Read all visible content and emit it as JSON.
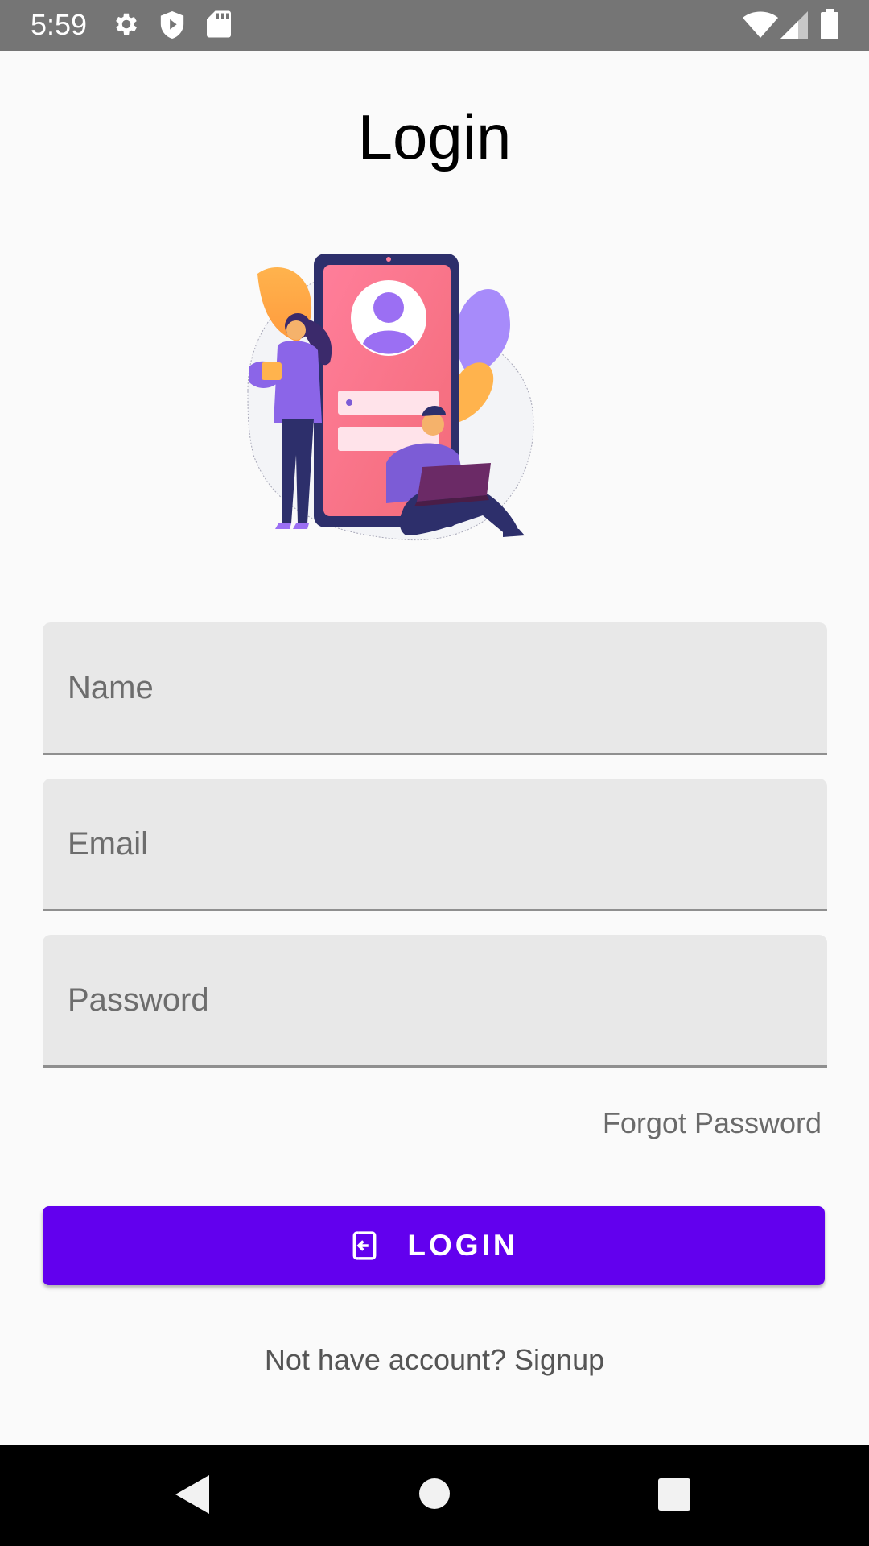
{
  "status_bar": {
    "time": "5:59",
    "icons": [
      "gear-icon",
      "shield-icon",
      "sd-card-icon",
      "wifi-icon",
      "signal-icon",
      "battery-icon"
    ]
  },
  "page": {
    "title": "Login"
  },
  "illustration": {
    "icon": "login-illustration"
  },
  "form": {
    "name": {
      "placeholder": "Name",
      "value": ""
    },
    "email": {
      "placeholder": "Email",
      "value": ""
    },
    "password": {
      "placeholder": "Password",
      "value": ""
    },
    "forgot_password": "Forgot Password",
    "login_button": {
      "label": "LOGIN",
      "icon": "login-icon"
    },
    "signup_prompt": "Not have account? Signup"
  },
  "nav_bar": {
    "buttons": [
      "back-icon",
      "home-icon",
      "recents-icon"
    ]
  },
  "colors": {
    "accent": "#6200ee",
    "status_bar": "#757575",
    "field_bg": "#e8e8e8"
  }
}
